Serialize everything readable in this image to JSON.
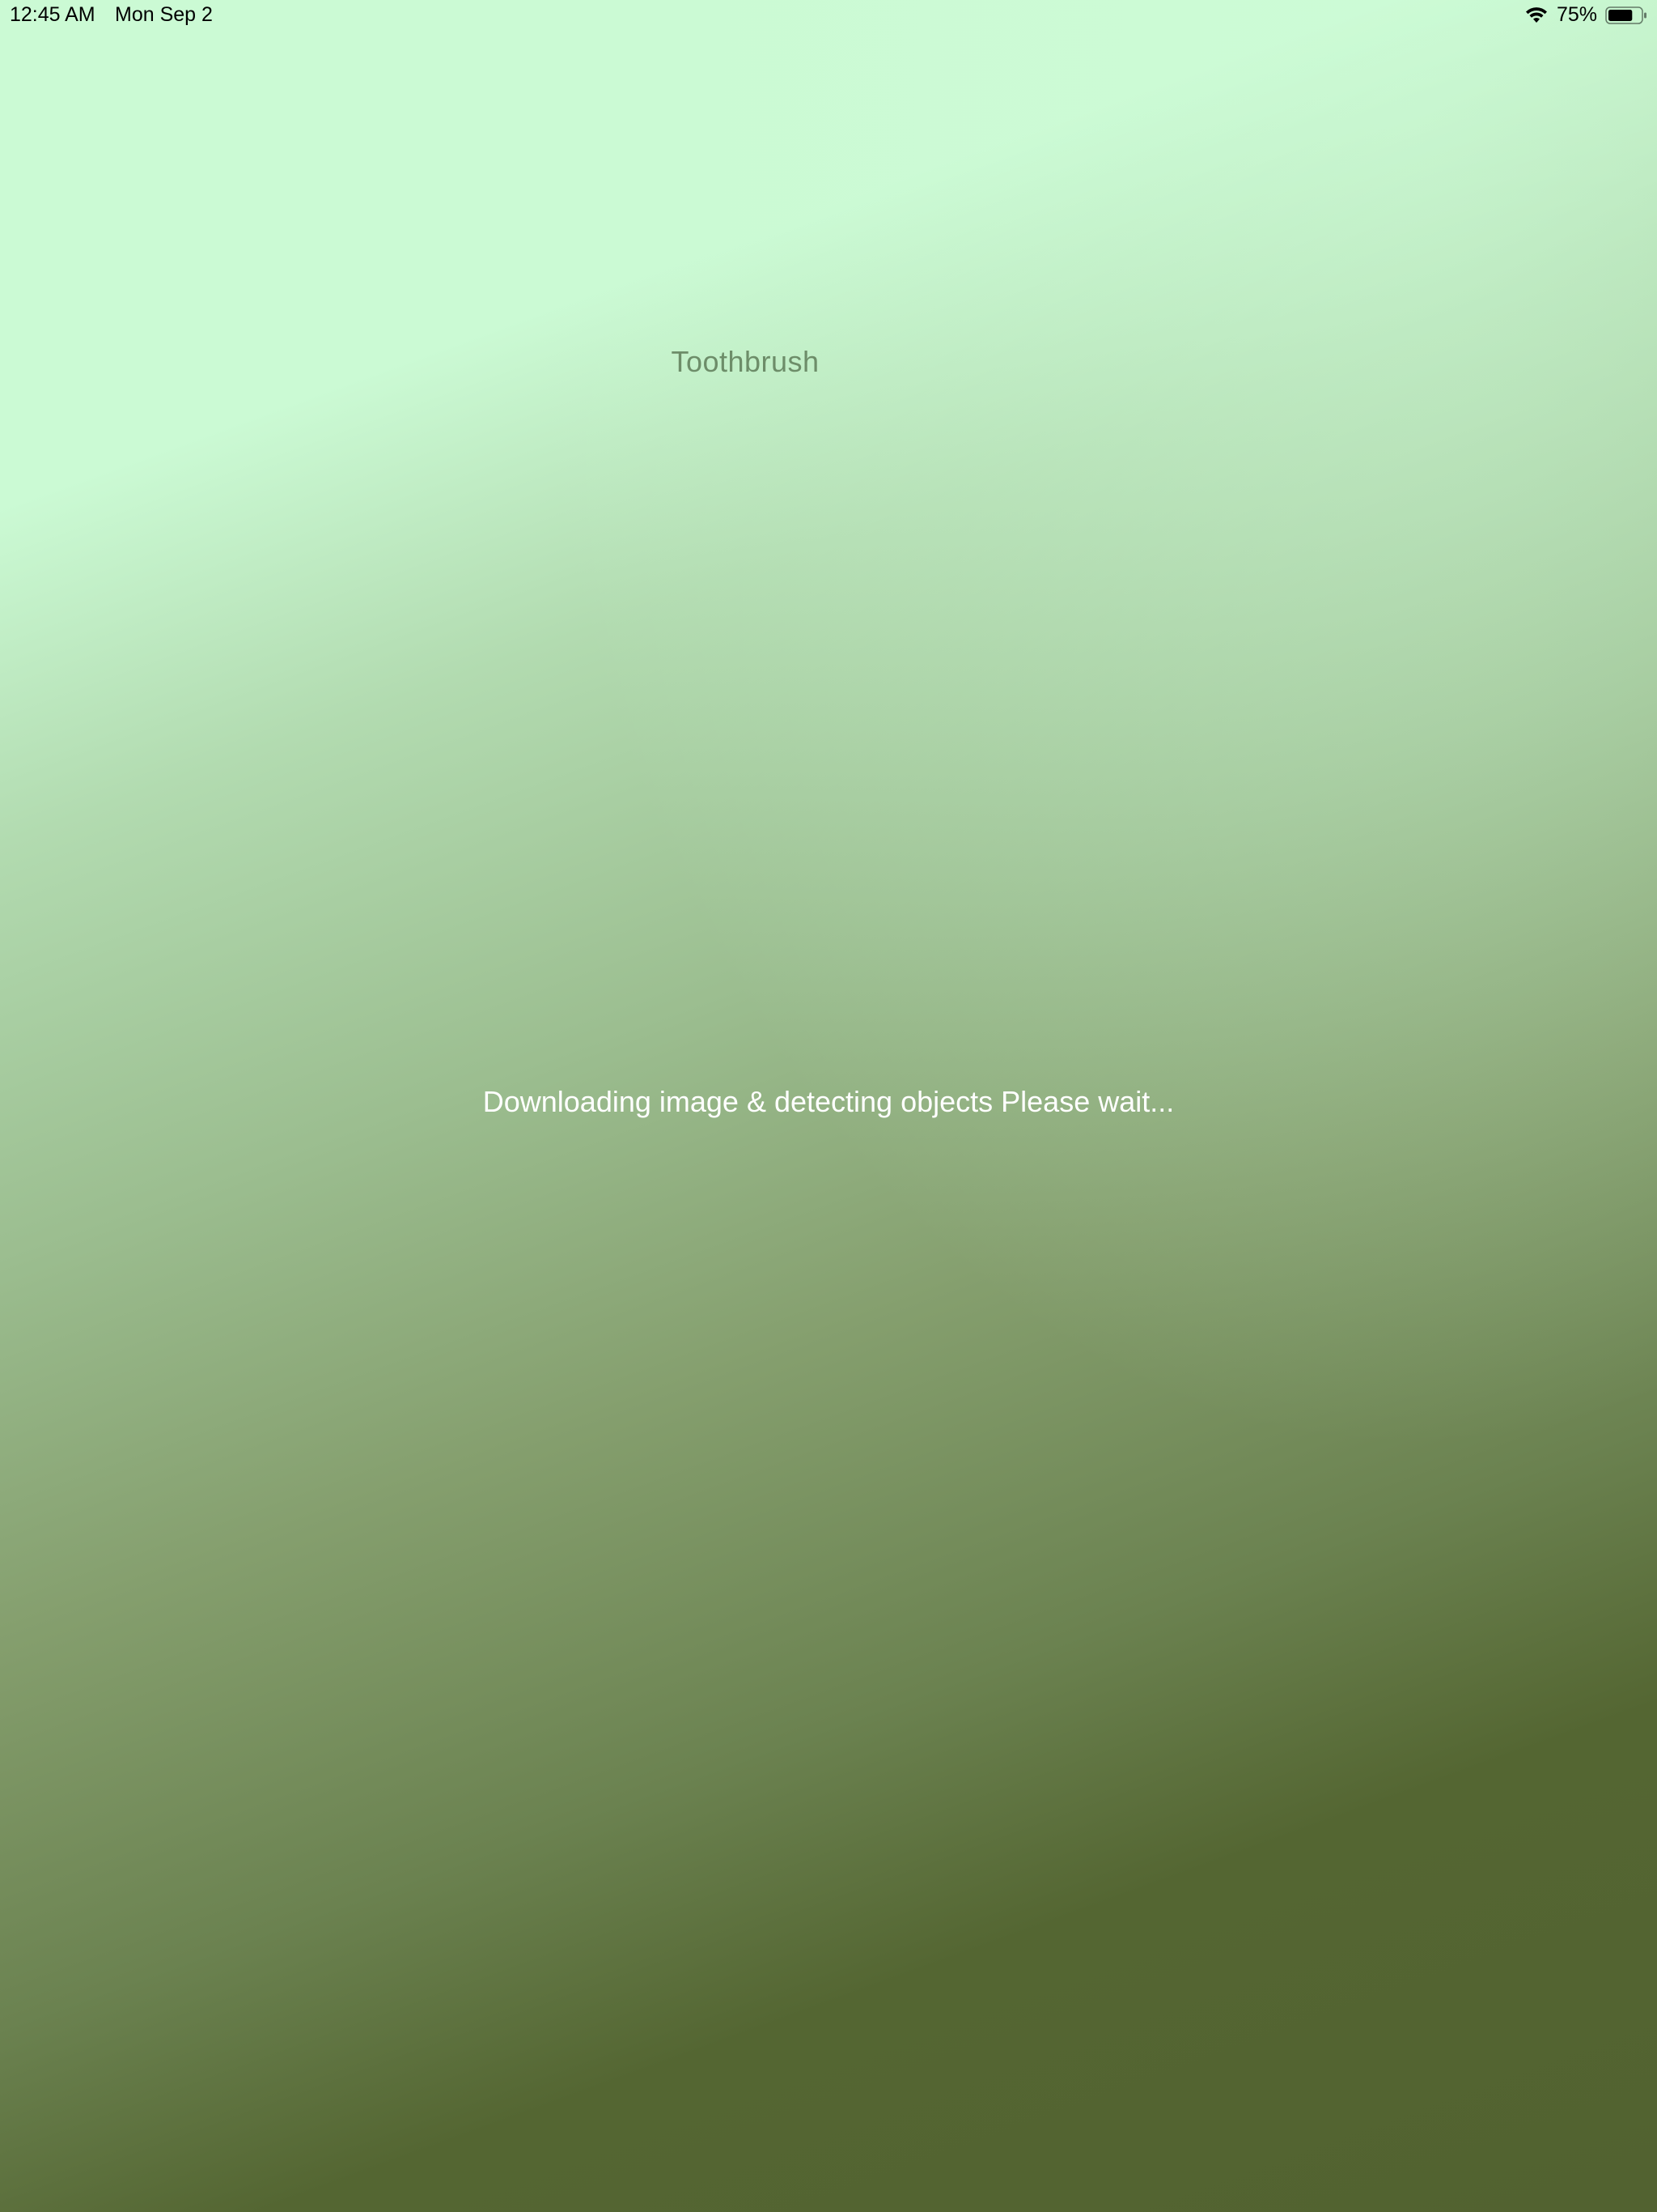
{
  "status_bar": {
    "time": "12:45 AM",
    "date": "Mon Sep 2",
    "battery_percent": "75%",
    "battery_level": 0.75,
    "wifi_icon": "wifi-icon",
    "battery_icon": "battery-icon"
  },
  "main": {
    "title": "Toothbrush",
    "loading_message": "Downloading image & detecting objects Please wait..."
  },
  "colors": {
    "gradient_top": "#cbfad4",
    "gradient_bottom": "#526230",
    "title_color": "#6d8d69",
    "loading_text_color": "#ffffff"
  }
}
